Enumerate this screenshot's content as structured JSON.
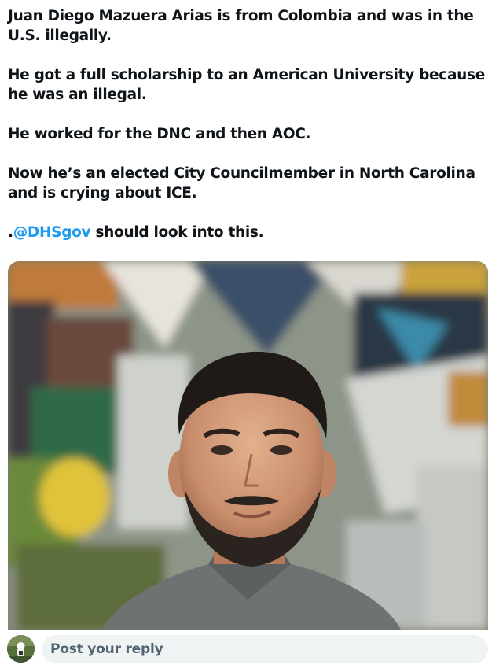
{
  "tweet": {
    "paragraphs": [
      "Juan Diego Mazuera Arias is from Colombia and was in the U.S. illegally.",
      "He got a full scholarship to an American University because he was an illegal.",
      "He worked for the DNC and then AOC.",
      "Now he’s an elected City Councilmember in North Carolina and is crying about ICE."
    ],
    "last_line": {
      "prefix": ".",
      "mention": "@DHSgov",
      "suffix": " should look into this."
    }
  },
  "media": {
    "description_icon": "photo"
  },
  "reply": {
    "placeholder": "Post your reply",
    "avatar_icon": "user-avatar"
  },
  "colors": {
    "text": "#0f1419",
    "mention": "#1d9bf0",
    "placeholder": "#536471",
    "input_bg": "#eff3f4"
  }
}
